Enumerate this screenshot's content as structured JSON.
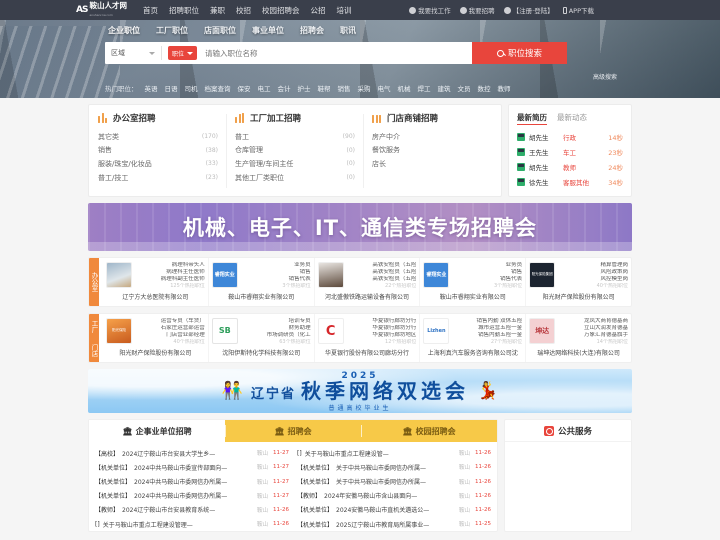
{
  "site": {
    "logo_mark": "AS",
    "logo_cn": "鞍山人才网",
    "logo_sub": "anshanrcw.com"
  },
  "topnav": {
    "links": [
      "首页",
      "招聘职位",
      "兼职",
      "校招",
      "校园招聘会",
      "公招",
      "培训"
    ],
    "right": [
      {
        "icon": "person-search-icon",
        "label": "我要找工作"
      },
      {
        "icon": "briefcase-icon",
        "label": "我要招聘"
      },
      {
        "icon": "user-icon",
        "label": "【注册·登陆】"
      },
      {
        "icon": "mobile-icon",
        "label": "APP下载"
      }
    ]
  },
  "hero": {
    "tabs": [
      "企业职位",
      "工厂职位",
      "店面职位",
      "事业单位",
      "招聘会",
      "职讯"
    ],
    "selected_tab": "企业职位",
    "search": {
      "region_label": "区域",
      "type_badge": "职位",
      "placeholder": "请输入职位名称",
      "value": "",
      "button_label": "职位搜索",
      "advanced_label": "高级搜索"
    },
    "hot": {
      "label": "热门职位：",
      "keywords": [
        "英语",
        "日语",
        "司机",
        "档案查询",
        "保安",
        "电工",
        "会计",
        "护士",
        "鞋帮",
        "销售",
        "采购",
        "电气",
        "机械",
        "焊工",
        "建筑",
        "文员",
        "数控",
        "教师"
      ]
    }
  },
  "categories": [
    {
      "icon": "office-building-icon",
      "title": "办公室招聘",
      "items": [
        {
          "name": "其它类",
          "count": "(170)"
        },
        {
          "name": "销售",
          "count": "(38)"
        },
        {
          "name": "服装/珠宝/化妆品",
          "count": "(33)"
        },
        {
          "name": "普工/技工",
          "count": "(23)"
        }
      ]
    },
    {
      "icon": "factory-icon",
      "title": "工厂加工招聘",
      "items": [
        {
          "name": "普工",
          "count": "(90)"
        },
        {
          "name": "仓库管理",
          "count": "(0)"
        },
        {
          "name": "生产管理/车间主任",
          "count": "(0)"
        },
        {
          "name": "其他工厂类职位",
          "count": "(0)"
        }
      ]
    },
    {
      "icon": "shop-icon",
      "title": "门店商铺招聘",
      "items": [
        {
          "name": "房产中介",
          "count": ""
        },
        {
          "name": "餐饮服务",
          "count": ""
        },
        {
          "name": "店长",
          "count": ""
        }
      ]
    }
  ],
  "resumes": {
    "tabs": [
      {
        "label": "最新简历",
        "active": true
      },
      {
        "label": "最新动态",
        "active": false
      }
    ],
    "rows": [
      {
        "name": "胡先生",
        "job": "行政",
        "time": "14秒"
      },
      {
        "name": "王先生",
        "job": "车工",
        "time": "23秒"
      },
      {
        "name": "胡先生",
        "job": "教师",
        "time": "24秒"
      },
      {
        "name": "徐先生",
        "job": "客服其他",
        "time": "34秒"
      }
    ]
  },
  "purple_banner": {
    "title": "机械、电子、IT、通信类专场招聘会"
  },
  "strips": [
    {
      "sidetabs": [
        {
          "label": "办公室",
          "active": true
        }
      ],
      "companies": [
        {
          "logo_text": "",
          "logo_style": "photo",
          "jobs": [
            "病理科带头人",
            "病理科主任医师",
            "病理科副主任医师"
          ],
          "more": "125个热招职位",
          "name": "辽宁方大总医院有限公司"
        },
        {
          "logo_text": "睿翔实业",
          "logo_style": "blue",
          "jobs": [
            "业务员",
            "销售",
            "销售代表"
          ],
          "more": "3个热招职位",
          "name": "鞍山市睿翔实业有限公司"
        },
        {
          "logo_text": "",
          "logo_style": "photo2",
          "jobs": [
            "高铁安检员（五险",
            "高铁安检员（五险",
            "高铁安检员（五险"
          ],
          "more": "22个热招职位",
          "name": "河北盛傲铁路运输设备有限公司"
        },
        {
          "logo_text": "睿翔实业",
          "logo_style": "blue",
          "jobs": [
            "业务员",
            "销售",
            "销售代表"
          ],
          "more": "3个热招职位",
          "name": "鞍山市睿翔实业有限公司"
        },
        {
          "logo_text": "阳光保险集团",
          "logo_style": "dark",
          "jobs": [
            "精算管理岗",
            "风险政策岗",
            "风控模型岗"
          ],
          "more": "40个热招职位",
          "name": "阳光财产保险股份有限公司"
        }
      ]
    },
    {
      "sidetabs": [
        {
          "label": "工厂",
          "active": false
        },
        {
          "label": "门店",
          "active": false
        }
      ],
      "companies": [
        {
          "logo_text": "阳光保险",
          "logo_style": "orange",
          "jobs": [
            "运营专员（车贷）",
            "石家庄运营部运营",
            "门店营业部经理"
          ],
          "more": "40个热招职位",
          "name": "阳光财产保险股份有限公司"
        },
        {
          "logo_text": "SB",
          "logo_style": "green",
          "jobs": [
            "培训专员",
            "财务助理",
            "市场调研员（化工"
          ],
          "more": "63个热招职位",
          "name": "沈阳伊斯特化学科技有限公司"
        },
        {
          "logo_text": "C",
          "logo_style": "red",
          "jobs": [
            "华夏银行廊坊分行",
            "华夏银行廊坊分行",
            "华夏银行廊坊地区"
          ],
          "more": "12个热招职位",
          "name": "华夏银行股份有限公司廊坊分行"
        },
        {
          "logo_text": "Lizhen",
          "logo_style": "white",
          "jobs": [
            "销售内勤 双休五险",
            "城市运营五险一金",
            "销售内勤五险一金"
          ],
          "more": "27个热招职位",
          "name": "上海利真汽车服务咨询有限公司沈"
        },
        {
          "logo_text": "坤达",
          "logo_style": "pink",
          "jobs": [
            "龙凤大商育德基商",
            "立山大润发育德基",
            "万象汇育德基旗手"
          ],
          "more": "14个热招职位",
          "name": "瑞坤达网络科技(大连)有限公司"
        }
      ]
    }
  ],
  "blue_banner": {
    "year": "2025",
    "province": "辽宁省",
    "main": "秋季网络双选会",
    "sub": "普通高校毕业生",
    "left_icon": "students-icon",
    "right_icon": "celebration-icon"
  },
  "bottom": {
    "tabs": [
      {
        "icon": "building-icon",
        "label": "企事业单位招聘",
        "active": true
      },
      {
        "icon": "jobfair-icon",
        "label": "招聘会",
        "active": false
      },
      {
        "icon": "campus-icon",
        "label": "校园招聘会",
        "active": false
      }
    ],
    "left_list": [
      {
        "tag": "【高校】",
        "text": "2024辽宁鞍山市台安县大学生乡—",
        "city": "鞍山",
        "date": "11-27"
      },
      {
        "tag": "【机关单位】",
        "text": "2024中共马鞍山市委宣传部面向—",
        "city": "鞍山",
        "date": "11-27"
      },
      {
        "tag": "【机关单位】",
        "text": "2024中共马鞍山市委网信办所属—",
        "city": "鞍山",
        "date": "11-27"
      },
      {
        "tag": "【机关单位】",
        "text": "2024中共马鞍山市委网信办所属—",
        "city": "鞍山",
        "date": "11-27"
      },
      {
        "tag": "【教师】",
        "text": "2024辽宁鞍山市台安县教育系统—",
        "city": "鞍山",
        "date": "11-26"
      },
      {
        "tag": "[]",
        "text": "关于马鞍山市重点工程建设管理—",
        "city": "鞍山",
        "date": "11-26"
      }
    ],
    "right_list": [
      {
        "tag": "[]",
        "text": "关于马鞍山市重点工程建设管—",
        "city": "鞍山",
        "date": "11-26"
      },
      {
        "tag": "【机关单位】",
        "text": "关于中共马鞍山市委网信办所属—",
        "city": "鞍山",
        "date": "11-26"
      },
      {
        "tag": "【机关单位】",
        "text": "关于中共马鞍山市委网信办所属—",
        "city": "鞍山",
        "date": "11-26"
      },
      {
        "tag": "【教师】",
        "text": "2024年安徽马鞍山市含山县面向—",
        "city": "鞍山",
        "date": "11-26"
      },
      {
        "tag": "【机关单位】",
        "text": "2024安徽马鞍山市直机关遴选公—",
        "city": "鞍山",
        "date": "11-26"
      },
      {
        "tag": "【机关单位】",
        "text": "2025辽宁鞍山市教育局所属事业—",
        "city": "鞍山",
        "date": "11-25"
      }
    ],
    "right_panel": {
      "icon": "service-icon",
      "title": "公共服务"
    }
  },
  "colors": {
    "accent_red": "#e8453c",
    "accent_yellow": "#f7c948",
    "accent_orange": "#f0893c",
    "nav_bg": "#3a3f4b"
  }
}
